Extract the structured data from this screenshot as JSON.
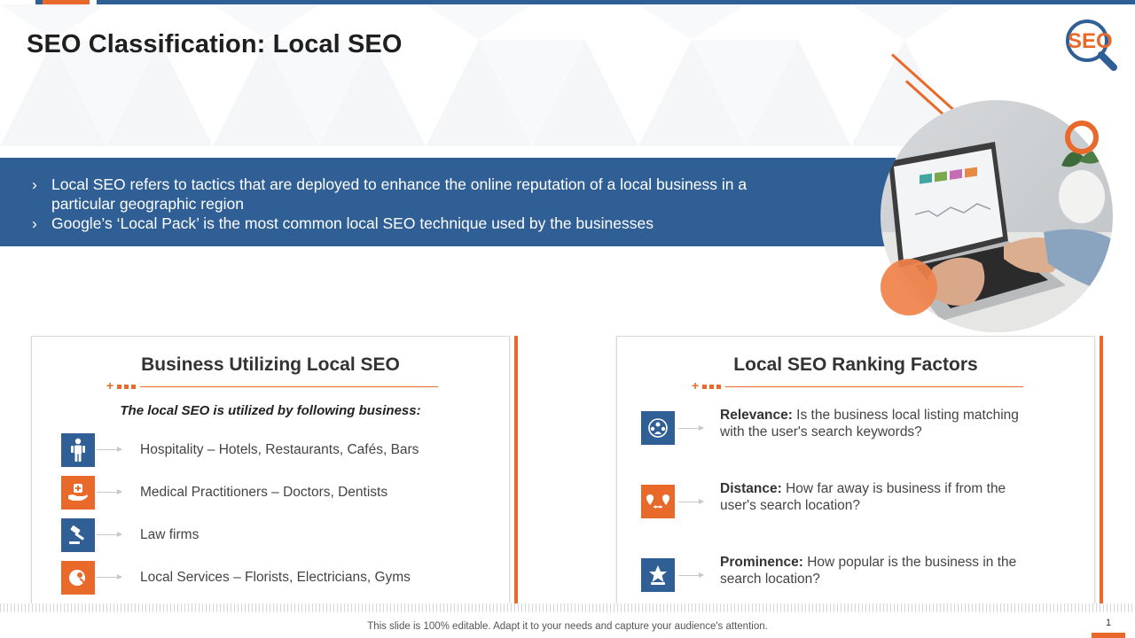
{
  "slide": {
    "title": "SEO Classification: Local SEO",
    "logo_text": "SEO",
    "colors": {
      "primary": "#2f5f95",
      "accent": "#e8692a"
    }
  },
  "intro": {
    "bullets": [
      "Local SEO refers to tactics that are deployed to enhance the online reputation of a local business in a particular geographic region",
      "Google’s ‘Local Pack’ is the most common local SEO technique used by the businesses"
    ]
  },
  "business_card": {
    "title": "Business Utilizing Local SEO",
    "subtitle": "The local SEO is utilized  by following business:",
    "items": [
      {
        "icon": "person-icon",
        "color": "blue",
        "text": "Hospitality – Hotels, Restaurants,  Cafés, Bars"
      },
      {
        "icon": "medical-hand-icon",
        "color": "orange",
        "text": "Medical Practitioners – Doctors, Dentists"
      },
      {
        "icon": "gavel-icon",
        "color": "blue",
        "text": "Law firms"
      },
      {
        "icon": "service-icon",
        "color": "orange",
        "text": "Local Services – Florists, Electricians, Gyms"
      }
    ]
  },
  "factors_card": {
    "title": "Local SEO Ranking Factors",
    "items": [
      {
        "icon": "people-group-icon",
        "color": "blue",
        "label": "Relevance:",
        "text": " Is the business local listing matching with the user's search keywords?"
      },
      {
        "icon": "location-distance-icon",
        "color": "orange",
        "label": "Distance:",
        "text": " How far away is business if from the user's search location?"
      },
      {
        "icon": "star-person-icon",
        "color": "blue",
        "label": "Prominence:",
        "text": " How popular is the business in the search location?"
      }
    ]
  },
  "footer": {
    "text": "This slide is 100% editable. Adapt it to your needs and capture your audience's attention.",
    "page_number": "1"
  }
}
